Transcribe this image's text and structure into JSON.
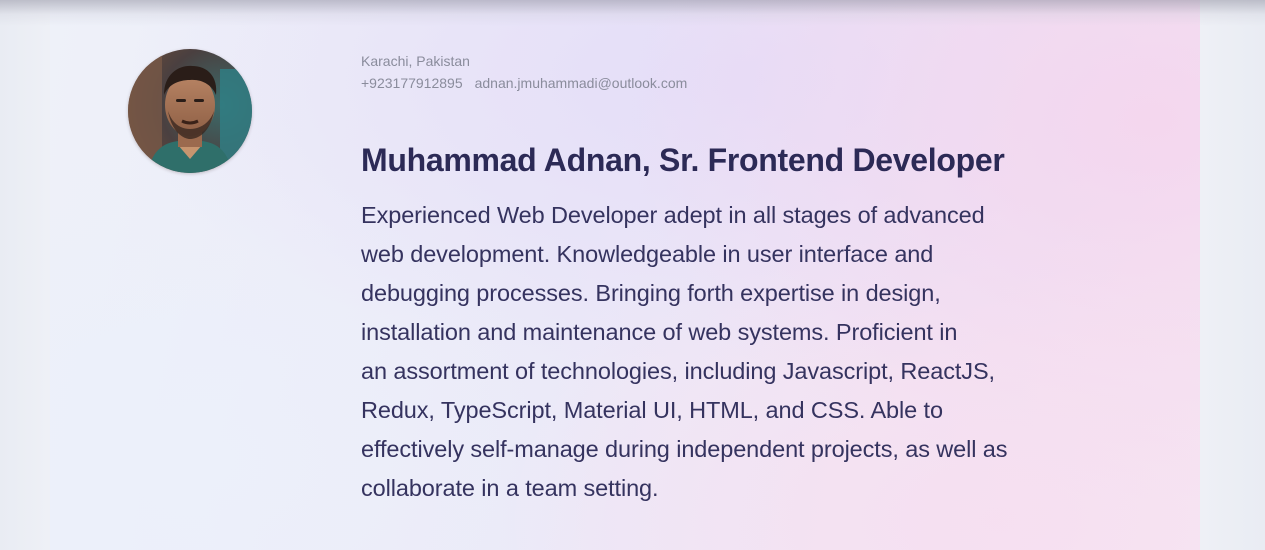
{
  "profile": {
    "location": "Karachi, Pakistan",
    "phone": "+923177912895",
    "email": "adnan.jmuhammadi@outlook.com",
    "headline": "Muhammad Adnan, Sr. Frontend Developer",
    "summary_lines": [
      "Experienced Web Developer adept in all stages of advanced",
      "web development. Knowledgeable in user interface and",
      "debugging processes. Bringing forth expertise in design,",
      "installation and maintenance of web systems. Proficient in",
      "an assortment of technologies, including Javascript, ReactJS,",
      "Redux, TypeScript, Material UI, HTML, and CSS. Able to",
      "effectively self-manage during independent projects, as well as",
      "collaborate in a team setting."
    ]
  },
  "colors": {
    "headline": "#2c2a56",
    "body_text": "#35335f",
    "contact_text": "#8a8c9c"
  }
}
